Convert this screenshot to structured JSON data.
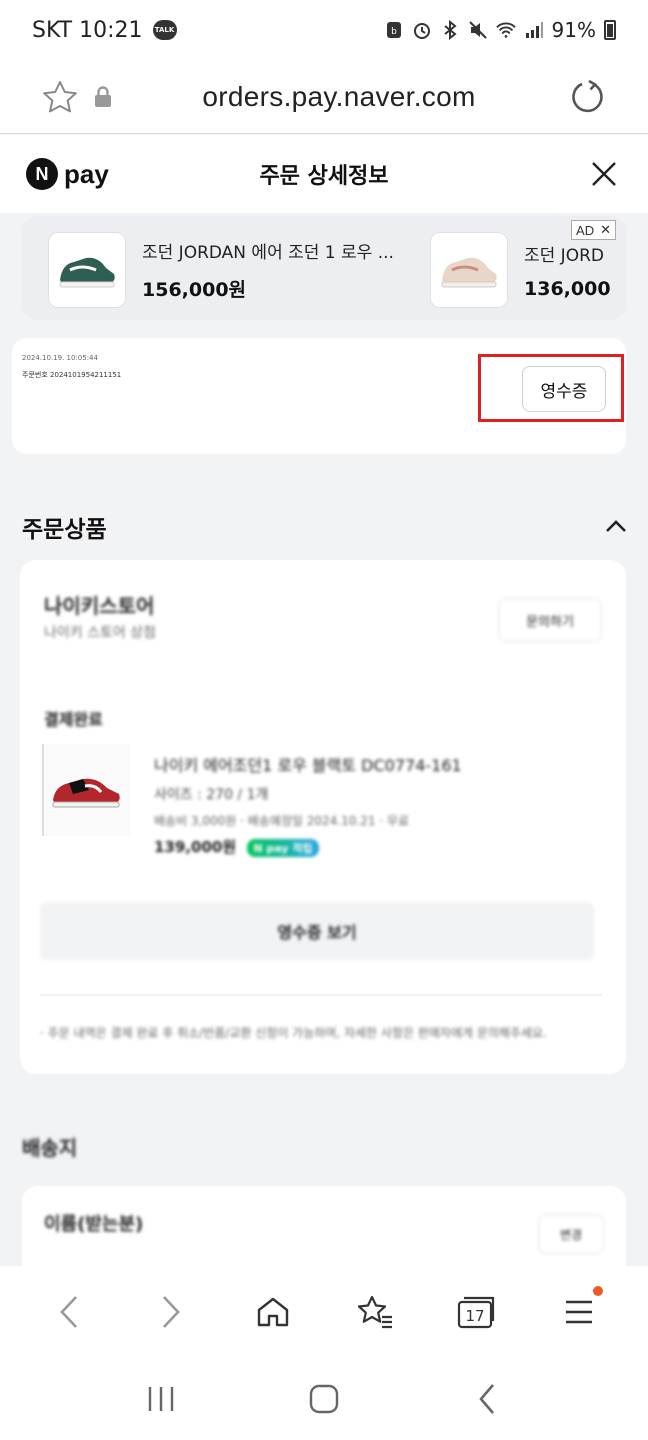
{
  "status_bar": {
    "carrier_time": "SKT 10:21",
    "talk_badge": "TALK",
    "battery": "91%"
  },
  "browser": {
    "url": "orders.pay.naver.com"
  },
  "header": {
    "logo_text": "pay",
    "logo_letter": "N",
    "title": "주문 상세정보"
  },
  "ad": {
    "badge": "AD",
    "items": [
      {
        "name": "조던 JORDAN 에어 조던 1 로우 ...",
        "price": "156,000원"
      },
      {
        "name": "조던 JORD",
        "price": "136,000"
      }
    ]
  },
  "order_info": {
    "date": "2024.10.19. 10:05:44",
    "order_number": "주문번호 2024101954211151",
    "receipt_button": "영수증"
  },
  "ordered_products": {
    "section_title": "주문상품",
    "seller_name": "나이키스토어",
    "seller_sub": "나이키 스토어 상점",
    "store_button": "문의하기",
    "status_label": "결제완료",
    "product": {
      "name": "나이키 에어조던1 로우 블랙토 DC0774-161",
      "option": "사이즈 : 270 / 1개",
      "shipping": "배송비 3,000원 · 배송예정일 2024.10.21 · 무료",
      "price": "139,000원",
      "badge": "N pay 적립"
    },
    "action_button": "영수증 보기",
    "notice": "· 주문 내역은 결제 완료 후 취소/반품/교환 신청이 가능하며, 자세한 사항은 판매자에게 문의해주세요."
  },
  "recipient": {
    "section_title": "배송지",
    "name": "이름(받는분)",
    "button": "변경"
  },
  "toolbar": {
    "tab_count": "17"
  }
}
